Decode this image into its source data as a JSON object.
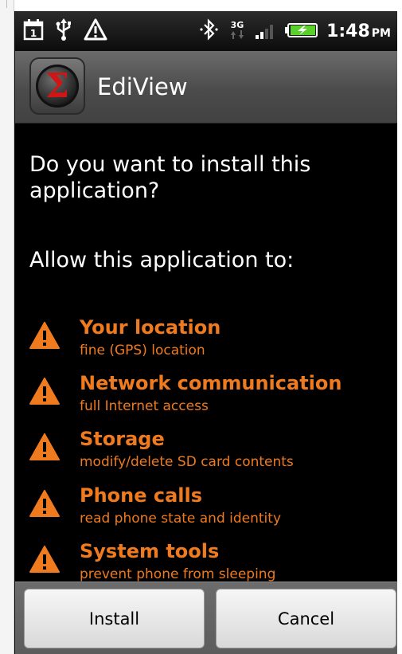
{
  "status_bar": {
    "time": "1:48",
    "ampm": "PM",
    "calendar_day": "1",
    "network_type": "3G",
    "icons": [
      "calendar-icon",
      "usb-icon",
      "warning-icon",
      "bluetooth-icon",
      "3g-data-icon",
      "signal-icon",
      "battery-charging-icon"
    ]
  },
  "app": {
    "title": "EdiView",
    "icon_letter": "Σ"
  },
  "dialog": {
    "question": "Do you want to install this application?",
    "allow_heading": "Allow this application to:",
    "permissions": [
      {
        "name": "Your location",
        "desc": "fine (GPS) location"
      },
      {
        "name": "Network communication",
        "desc": "full Internet access"
      },
      {
        "name": "Storage",
        "desc": "modify/delete SD card contents"
      },
      {
        "name": "Phone calls",
        "desc": "read phone state and identity"
      },
      {
        "name": "System tools",
        "desc": "prevent phone from sleeping"
      }
    ]
  },
  "buttons": {
    "install": "Install",
    "cancel": "Cancel"
  },
  "colors": {
    "accent_orange": "#f07a1e",
    "background": "#000000",
    "title_bar": "#555555",
    "battery_green": "#5ad02a"
  }
}
